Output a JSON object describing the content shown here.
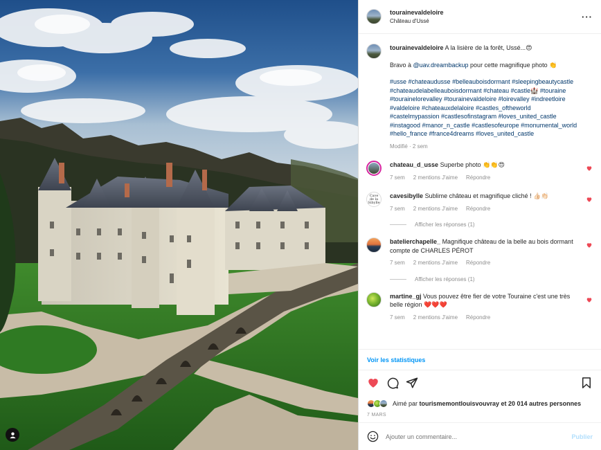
{
  "post": {
    "username": "tourainevaldeloire",
    "location": "Château d'Ussé"
  },
  "caption": {
    "username": "tourainevaldeloire",
    "line1": "A la lisière de la forêt, Ussé...😍",
    "line2_prefix": "Bravo à ",
    "mention": "@uav.dreambackup",
    "line2_suffix": " pour cette magnifique photo 👏",
    "hashtags": "#usse #chateaudusse #belleauboisdormant #sleepingbeautycastle #chateaudelabelleauboisdormant #chateau #castle🏰 #touraine #tourainelorevalley #tourainevaldeloire #loirevalley #indreetloire #valdeloire #chateauxdelaloire #castles_oftheworld #castelmypassion #castlesofinstagram #loves_united_castle #instagood #manor_n_castle #castlesofeurope #monumental_world #hello_france #france4dreams #loves_united_castle",
    "hashtags_lines": [
      "#usse #chateaudusse #belleauboisdormant #sleepingbeautycastle",
      "#chateaudelabelleauboisdormant #chateau #castle🏰 #touraine",
      "#tourainelorevalley #tourainevaldeloire #loirevalley #indreetloire",
      "#valdeloire #chateauxdelaloire #castles_oftheworld",
      "#castelmypassion #castlesofinstagram #loves_united_castle",
      "#instagood #manor_n_castle #castlesofeurope #monumental_world",
      "#hello_france #france4dreams #loves_united_castle"
    ],
    "meta": "Modifié · 2 sem"
  },
  "comments": [
    {
      "username": "chateau_d_usse",
      "text": "Superbe photo 👏👏😍",
      "time": "7 sem",
      "likes": "2 mentions J'aime",
      "reply": "Répondre",
      "view_replies": ""
    },
    {
      "username": "cavesibylle",
      "text": "Sublime château et magnifique cliché ! 👍🏻👏🏻",
      "time": "7 sem",
      "likes": "2 mentions J'aime",
      "reply": "Répondre",
      "view_replies": "Afficher les réponses (1)"
    },
    {
      "username": "batelierchapelle_",
      "text": "Magnifique château de la belle au bois dormant compte de CHARLES PÉROT",
      "time": "7 sem",
      "likes": "2 mentions J'aime",
      "reply": "Répondre",
      "view_replies": "Afficher les réponses (1)"
    },
    {
      "username": "martine_gj",
      "text": "Vous pouvez être fier de votre Touraine c'est une très belle région ❤️❤️❤️",
      "time": "7 sem",
      "likes": "2 mentions J'aime",
      "reply": "Répondre",
      "view_replies": ""
    }
  ],
  "avatar_text": "Cave de la Sibylle",
  "stats_link": "Voir les statistiques",
  "likes": {
    "prefix": "Aimé par ",
    "user": "tourismemontlouisvouvray",
    "suffix": " et 20 014 autres personnes"
  },
  "date": "7 MARS",
  "add_comment": {
    "placeholder": "Ajouter un commentaire...",
    "post_label": "Publier"
  },
  "colors": {
    "like_red": "#ed4956",
    "link_blue": "#00376b",
    "stats_blue": "#0095f6",
    "post_disabled": "#b2dffc"
  }
}
